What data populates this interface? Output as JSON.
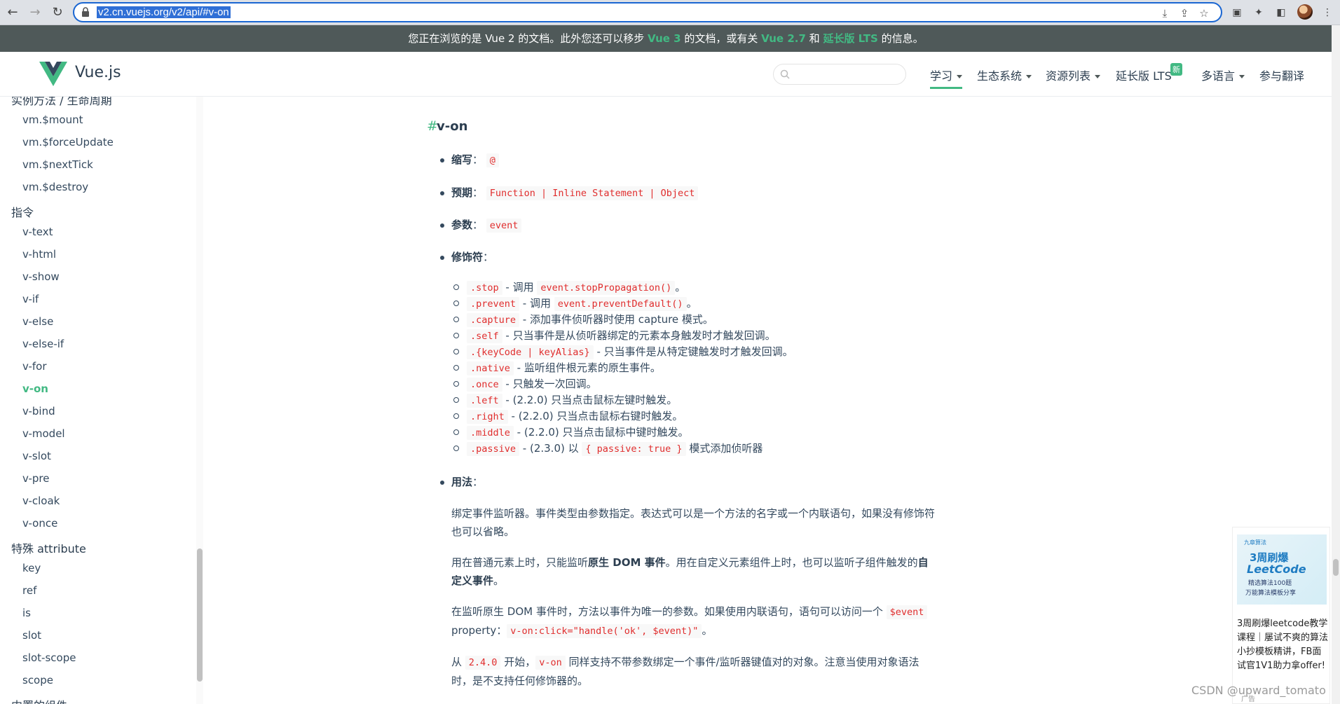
{
  "browser": {
    "url": "v2.cn.vuejs.org/v2/api/#v-on"
  },
  "banner": {
    "text_prefix": "您正在浏览的是 Vue 2 的文档。此外您还可以移步 ",
    "link_vue3": "Vue 3",
    "text_mid1": " 的文档，或有关 ",
    "link_vue27": "Vue 2.7",
    "text_mid2": " 和 ",
    "link_lts": "延长版 LTS",
    "text_suffix": " 的信息。"
  },
  "header": {
    "brand": "Vue.js",
    "nav": [
      "学习",
      "生态系统",
      "资源列表",
      "延长版 LTS",
      "多语言",
      "参与翻译"
    ],
    "new_badge": "新"
  },
  "sidebar": {
    "cut_top": "实例方法 / 生命周期",
    "items_a": [
      "vm.$mount",
      "vm.$forceUpdate",
      "vm.$nextTick",
      "vm.$destroy"
    ],
    "group_directives": "指令",
    "items_b": [
      "v-text",
      "v-html",
      "v-show",
      "v-if",
      "v-else",
      "v-else-if",
      "v-for",
      "v-on",
      "v-bind",
      "v-model",
      "v-slot",
      "v-pre",
      "v-cloak",
      "v-once"
    ],
    "group_special": "特殊 attribute",
    "items_c": [
      "key",
      "ref",
      "is",
      "slot",
      "slot-scope",
      "scope"
    ],
    "cut_bottom": "内置的组件",
    "active": "v-on"
  },
  "content": {
    "anchor": "#",
    "title": "v-on",
    "shorthand_label": "缩写",
    "shorthand_value": "@",
    "expects_label": "预期",
    "expects_value": "Function | Inline Statement | Object",
    "argument_label": "参数",
    "argument_value": "event",
    "modifiers_label": "修饰符",
    "modifiers": [
      {
        "code": ".stop",
        "text": " - 调用 ",
        "code2": "event.stopPropagation()",
        "tail": "。"
      },
      {
        "code": ".prevent",
        "text": " - 调用 ",
        "code2": "event.preventDefault()",
        "tail": "。"
      },
      {
        "code": ".capture",
        "text": " - 添加事件侦听器时使用 capture 模式。",
        "code2": "",
        "tail": ""
      },
      {
        "code": ".self",
        "text": " - 只当事件是从侦听器绑定的元素本身触发时才触发回调。",
        "code2": "",
        "tail": ""
      },
      {
        "code": ".{keyCode | keyAlias}",
        "text": " - 只当事件是从特定键触发时才触发回调。",
        "code2": "",
        "tail": ""
      },
      {
        "code": ".native",
        "text": " - 监听组件根元素的原生事件。",
        "code2": "",
        "tail": ""
      },
      {
        "code": ".once",
        "text": " - 只触发一次回调。",
        "code2": "",
        "tail": ""
      },
      {
        "code": ".left",
        "text": " - (2.2.0) 只当点击鼠标左键时触发。",
        "code2": "",
        "tail": ""
      },
      {
        "code": ".right",
        "text": " - (2.2.0) 只当点击鼠标右键时触发。",
        "code2": "",
        "tail": ""
      },
      {
        "code": ".middle",
        "text": " - (2.2.0) 只当点击鼠标中键时触发。",
        "code2": "",
        "tail": ""
      },
      {
        "code": ".passive",
        "text": " - (2.3.0) 以 ",
        "code2": "{ passive: true }",
        "tail": " 模式添加侦听器"
      }
    ],
    "usage_label": "用法",
    "para1": "绑定事件监听器。事件类型由参数指定。表达式可以是一个方法的名字或一个内联语句，如果没有修饰符也可以省略。",
    "para2_a": "用在普通元素上时，只能监听",
    "para2_b": "原生 DOM 事件",
    "para2_c": "。用在自定义元素组件上时，也可以监听子组件触发的",
    "para2_d": "自定义事件",
    "para2_e": "。",
    "para3_a": "在监听原生 DOM 事件时，方法以事件为唯一的参数。如果使用内联语句，语句可以访问一个 ",
    "para3_code1": "$event",
    "para3_b": " property：",
    "para3_code2": "v-on:click=\"handle('ok', $event)\"",
    "para3_c": "。",
    "para4_a": "从 ",
    "para4_code1": "2.4.0",
    "para4_b": " 开始，",
    "para4_code2": "v-on",
    "para4_c": " 同样支持不带参数绑定一个事件/监听器键值对的对象。注意当使用对象语法时，是不支持任何修饰器的。"
  },
  "ad": {
    "img_brand": "九章算法",
    "img_line1": "3周刷爆",
    "img_line2": "LeetCode",
    "img_line3": "精选算法100题",
    "img_line4": "万能算法模板分享",
    "text": "3周刷爆leetcode教学课程｜屡试不爽的算法小抄模板精讲，FB面试官1V1助力拿offer!",
    "label": "广告"
  },
  "watermark": "CSDN @upward_tomato",
  "colors": {
    "accent": "#42b983",
    "banner_bg": "#4f5959",
    "code": "#e02d2d"
  }
}
